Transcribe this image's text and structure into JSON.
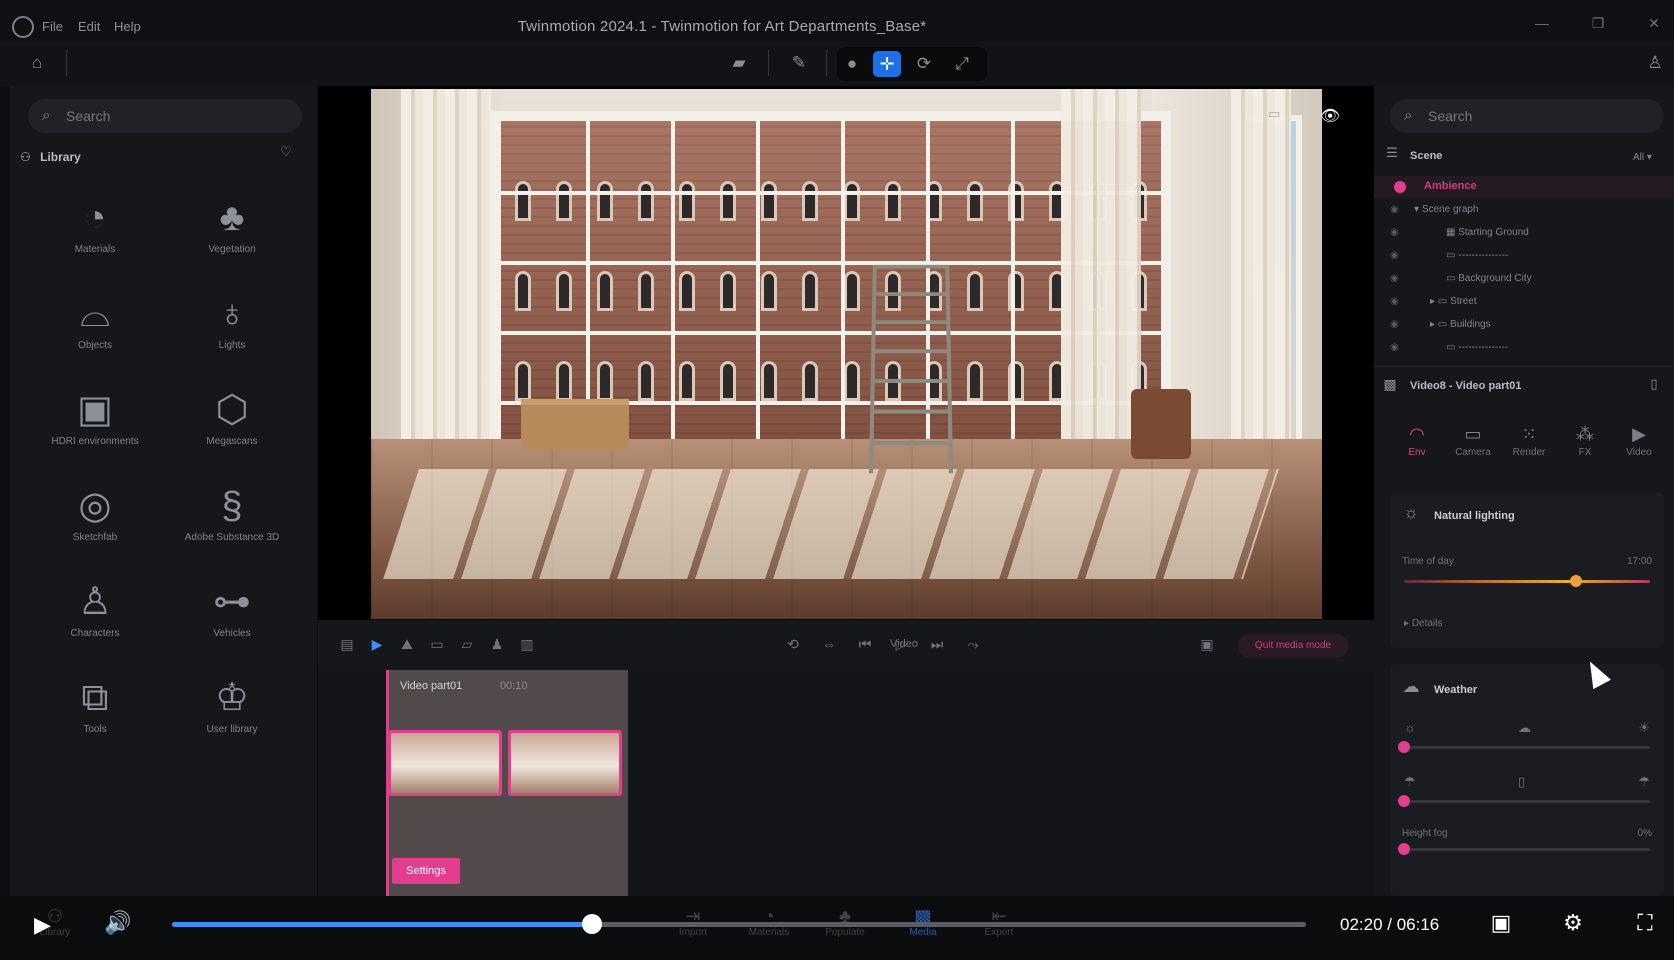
{
  "window": {
    "title": "Twinmotion 2024.1 - Twinmotion for Art Departments_Base*",
    "menu": [
      "File",
      "Edit",
      "Help"
    ]
  },
  "left_panel": {
    "search_placeholder": "Search",
    "library_label": "Library",
    "items": [
      {
        "label": "Materials",
        "icon": "materials-icon"
      },
      {
        "label": "Vegetation",
        "icon": "tree-icon"
      },
      {
        "label": "Objects",
        "icon": "sofa-icon"
      },
      {
        "label": "Lights",
        "icon": "lightbulb-icon"
      },
      {
        "label": "HDRI environments",
        "icon": "image-icon"
      },
      {
        "label": "Megascans",
        "icon": "megascans-icon"
      },
      {
        "label": "Sketchfab",
        "icon": "sketchfab-icon"
      },
      {
        "label": "Adobe Substance 3D",
        "icon": "substance-icon"
      },
      {
        "label": "Characters",
        "icon": "character-icon"
      },
      {
        "label": "Vehicles",
        "icon": "car-icon"
      },
      {
        "label": "Tools",
        "icon": "cubes-icon"
      },
      {
        "label": "User library",
        "icon": "user-library-icon"
      }
    ]
  },
  "media_bar": {
    "video_label": "Video",
    "quit_label": "Quit media mode"
  },
  "timeline": {
    "clip_title": "Video part01",
    "clip_duration": "00:10",
    "settings_label": "Settings"
  },
  "right_panel": {
    "search_placeholder": "Search",
    "scene_label": "Scene",
    "filter": "All",
    "ambience_label": "Ambience",
    "tree": [
      {
        "label": "Scene graph",
        "indent": 0
      },
      {
        "label": "Starting Ground",
        "indent": 1
      },
      {
        "label": "---------------",
        "indent": 1
      },
      {
        "label": "Background City",
        "indent": 1
      },
      {
        "label": "Street",
        "indent": 1
      },
      {
        "label": "Buildings",
        "indent": 1
      },
      {
        "label": "---------------",
        "indent": 1
      }
    ],
    "video_header": "Video8 - Video part01",
    "tabs": [
      {
        "label": "Env",
        "icon": "env-icon"
      },
      {
        "label": "Camera",
        "icon": "camera-icon"
      },
      {
        "label": "Render",
        "icon": "render-icon"
      },
      {
        "label": "FX",
        "icon": "fx-icon"
      },
      {
        "label": "Video",
        "icon": "video-icon"
      }
    ],
    "natural_lighting": "Natural lighting",
    "time_of_day_label": "Time of day",
    "time_of_day_value": "17:00",
    "time_of_day_fraction": 0.7,
    "details_label": "Details",
    "weather_label": "Weather",
    "height_fog_label": "Height fog",
    "height_fog_value": "0%"
  },
  "bottom_tabs": [
    {
      "label": "Library"
    },
    {
      "label": "Import"
    },
    {
      "label": "Materials"
    },
    {
      "label": "Populate"
    },
    {
      "label": "Media"
    },
    {
      "label": "Export"
    }
  ],
  "player": {
    "current_time": "02:20",
    "total_time": "06:16",
    "time_display": "02:20 / 06:16",
    "progress_fraction": 0.37
  },
  "colors": {
    "accent_pink": "#e23d8e",
    "accent_blue": "#1f6fe6",
    "seek_blue": "#3e8ef7"
  }
}
